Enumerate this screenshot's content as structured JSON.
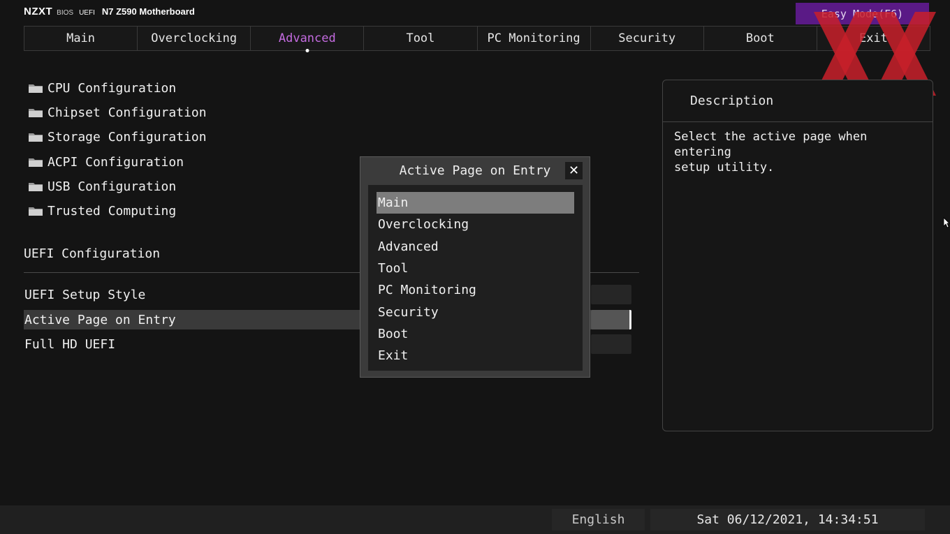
{
  "header": {
    "brand": "NZXT",
    "bios": "BIOS",
    "uefi": "UEFI",
    "model": "N7 Z590 Motherboard",
    "easy_mode_label": "Easy Mode(F6)"
  },
  "tabs": [
    {
      "label": "Main"
    },
    {
      "label": "Overclocking"
    },
    {
      "label": "Advanced"
    },
    {
      "label": "Tool"
    },
    {
      "label": "PC Monitoring"
    },
    {
      "label": "Security"
    },
    {
      "label": "Boot"
    },
    {
      "label": "Exit"
    }
  ],
  "active_tab": "Advanced",
  "folders": [
    {
      "label": "CPU Configuration"
    },
    {
      "label": "Chipset Configuration"
    },
    {
      "label": "Storage Configuration"
    },
    {
      "label": "ACPI Configuration"
    },
    {
      "label": "USB Configuration"
    },
    {
      "label": "Trusted Computing"
    }
  ],
  "uefi_section": {
    "title": "UEFI Configuration",
    "options": [
      {
        "label": "UEFI Setup Style"
      },
      {
        "label": "Active Page on Entry"
      },
      {
        "label": "Full HD UEFI"
      }
    ],
    "selected_option": "Active Page on Entry"
  },
  "description": {
    "title": "Description",
    "text_line1": "Select the active page when entering",
    "text_line2": "setup utility."
  },
  "popup": {
    "title": "Active Page on Entry",
    "items": [
      {
        "label": "Main"
      },
      {
        "label": "Overclocking"
      },
      {
        "label": "Advanced"
      },
      {
        "label": "Tool"
      },
      {
        "label": "PC Monitoring"
      },
      {
        "label": "Security"
      },
      {
        "label": "Boot"
      },
      {
        "label": "Exit"
      }
    ],
    "selected_item": "Main"
  },
  "footer": {
    "language": "English",
    "datetime": "Sat 06/12/2021, 14:34:51"
  },
  "colors": {
    "accent": "#c46be0",
    "easy_mode_bg": "#5a1a86",
    "watermark": "#c8202a"
  }
}
